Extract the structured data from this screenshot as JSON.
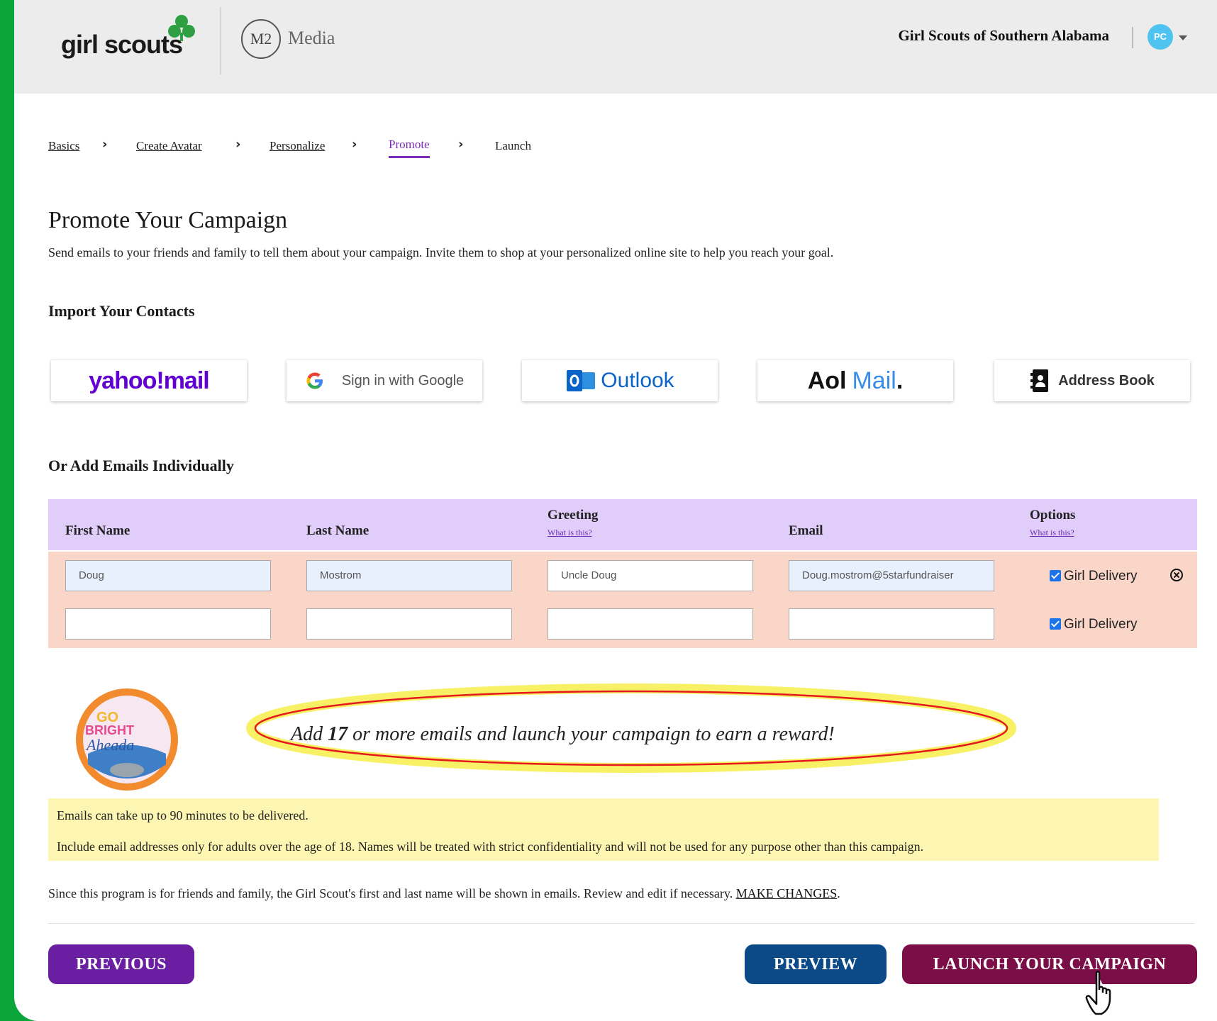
{
  "header": {
    "logo_text": "girl scouts",
    "m2_mark": "M2",
    "m2_text": "Media",
    "council": "Girl Scouts of Southern Alabama",
    "avatar_initials": "PC"
  },
  "breadcrumbs": [
    "Basics",
    "Create Avatar",
    "Personalize",
    "Promote",
    "Launch"
  ],
  "page": {
    "title": "Promote Your Campaign",
    "subtitle": "Send emails to your friends and family to tell them about your campaign. Invite them to shop at your personalized online site to help you reach your goal."
  },
  "import": {
    "heading": "Import Your Contacts",
    "yahoo": "yahoo!mail",
    "google": "Sign in with Google",
    "outlook": "Outlook",
    "aol_a": "Aol",
    "aol_b": "Mail",
    "aol_c": ".",
    "address_book": "Address Book"
  },
  "emails": {
    "heading": "Or Add Emails Individually",
    "columns": {
      "first": "First Name",
      "last": "Last Name",
      "greeting": "Greeting",
      "greeting_help": "What is this?",
      "email": "Email",
      "options": "Options",
      "options_help": "What is this?"
    },
    "rows": [
      {
        "first": "Doug",
        "last": "Mostrom",
        "greeting": "Uncle Doug",
        "email": "Doug.mostrom@5starfundraiser",
        "option": "Girl Delivery"
      },
      {
        "first": "",
        "last": "",
        "greeting": "",
        "email": "",
        "option": "Girl Delivery"
      }
    ]
  },
  "reward": {
    "text_a": "Add ",
    "count": "17",
    "text_b": " or more emails and launch your campaign to earn a reward!",
    "badge_text_1": "GO",
    "badge_text_2": "BRIGHT",
    "badge_text_3": "Aheada"
  },
  "notices": {
    "line1": "Emails can take up to 90 minutes to be delivered.",
    "line2": "Include email addresses only for adults over the age of 18. Names will be treated with strict confidentiality and will not be used for any purpose other than this campaign."
  },
  "bottom_note": {
    "text": "Since this program is for friends and family, the Girl Scout's first and last name will be shown in emails. Review and edit if necessary. ",
    "link": "MAKE CHANGES",
    "tail": "."
  },
  "buttons": {
    "previous": "PREVIOUS",
    "preview": "PREVIEW",
    "launch": "LAUNCH YOUR CAMPAIGN"
  },
  "colors": {
    "green_border": "#0aa63c",
    "purple": "#6a1fa3",
    "navy": "#0b4a86",
    "maroon": "#7b0e46",
    "table_header": "#e0cdfa",
    "table_row": "#f9d6c8",
    "notice": "#fdf6b2"
  }
}
